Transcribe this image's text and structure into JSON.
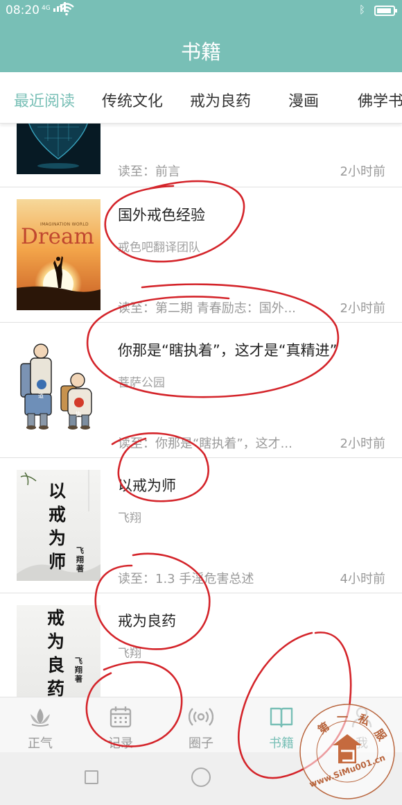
{
  "status_bar": {
    "time": "08:20",
    "network": "4G",
    "battery_level": 0.9
  },
  "header": {
    "title": "书籍"
  },
  "tabs": [
    {
      "label": "最近阅读",
      "active": true
    },
    {
      "label": "传统文化",
      "active": false
    },
    {
      "label": "戒为良药",
      "active": false
    },
    {
      "label": "漫画",
      "active": false
    },
    {
      "label": "佛学书",
      "active": false
    }
  ],
  "books": [
    {
      "title": "",
      "author": "",
      "progress": "读至：前言",
      "time": "2小时前"
    },
    {
      "title": "国外戒色经验",
      "author": "戒色吧翻译团队",
      "progress": "读至：第二期 青春励志：国外...",
      "time": "2小时前",
      "cover_text": "IMAGINATION WORLD",
      "cover_word": "Dream"
    },
    {
      "title": "你那是“瞎执着”，这才是“真精进”",
      "author": "菩萨公园",
      "progress": "读至：你那是“瞎执着”，这才...",
      "time": "2小时前",
      "cover_badges": [
        "道",
        "执"
      ]
    },
    {
      "title": "以戒为师",
      "author": "飞翔",
      "progress": "读至：1.3 手淫危害总述",
      "time": "4小时前",
      "cover_title": "以戒为师",
      "cover_author": "飞翔著"
    },
    {
      "title": "戒为良药",
      "author": "飞翔",
      "progress": "",
      "time": "",
      "cover_title": "戒为良药",
      "cover_author": "飞翔著"
    }
  ],
  "bottom_nav": [
    {
      "label": "正气",
      "icon": "lotus-icon",
      "active": false
    },
    {
      "label": "记录",
      "icon": "calendar-icon",
      "active": false
    },
    {
      "label": "圈子",
      "icon": "broadcast-icon",
      "active": false
    },
    {
      "label": "书籍",
      "icon": "book-icon",
      "active": true
    },
    {
      "label": "我",
      "icon": "person-icon",
      "active": false
    }
  ],
  "watermark": {
    "chars": [
      "第",
      "一",
      "私",
      "服"
    ],
    "url": "www.SiMu001.cn"
  },
  "colors": {
    "accent": "#78bfb6",
    "annotation": "#d4242a",
    "text": "#222222",
    "muted": "#999999"
  }
}
